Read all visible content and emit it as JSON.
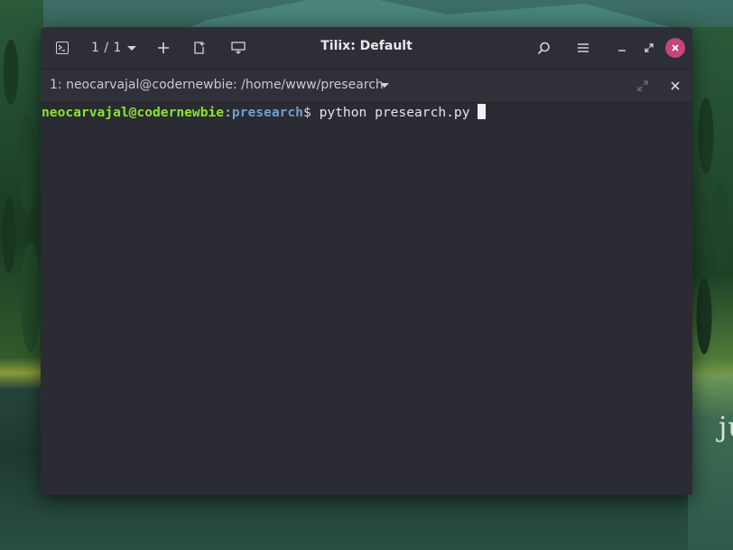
{
  "window": {
    "title": "Tilix: Default",
    "session_counter": "1 / 1",
    "accent_close_color": "#c4457a"
  },
  "headerbar": {
    "icons": [
      "terminal-icon",
      "chevron-down-icon",
      "add-icon",
      "new-window-icon",
      "sync-input-icon",
      "search-icon",
      "menu-icon",
      "minimize-icon",
      "maximize-icon",
      "close-icon"
    ]
  },
  "tab": {
    "title": "1: neocarvajal@codernewbie: /home/www/presearch"
  },
  "terminal": {
    "prompt_user": "neocarvajal@codernewbie",
    "prompt_colon": ":",
    "prompt_path": "presearch",
    "prompt_symbol": "$",
    "command": "python presearch.py",
    "user_color": "#8ae234",
    "path_color": "#729fcf"
  },
  "desktop": {
    "partial_text": "ju"
  }
}
